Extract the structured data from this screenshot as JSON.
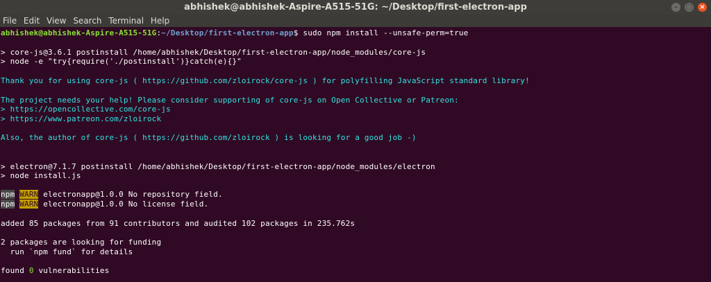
{
  "window": {
    "title": "abhishek@abhishek-Aspire-A515-51G: ~/Desktop/first-electron-app",
    "minimize_glyph": "–",
    "maximize_glyph": "□",
    "close_glyph": "×"
  },
  "menubar": {
    "items": [
      "File",
      "Edit",
      "View",
      "Search",
      "Terminal",
      "Help"
    ]
  },
  "prompt": {
    "user_host": "abhishek@abhishek-Aspire-A515-51G",
    "separator": ":",
    "path": "~/Desktop/first-electron-app",
    "command": "$ sudo npm install --unsafe-perm=true"
  },
  "output": {
    "corejs_postinstall": "> core-js@3.6.1 postinstall /home/abhishek/Desktop/first-electron-app/node_modules/core-js",
    "corejs_node": "> node -e \"try{require('./postinstall')}catch(e){}\"",
    "thanks": "Thank you for using core-js ( https://github.com/zloirock/core-js ) for polyfilling JavaScript standard library!",
    "needs_help": "The project needs your help! Please consider supporting of core-js on Open Collective or Patreon:",
    "opencollective": "> https://opencollective.com/core-js",
    "patreon": "> https://www.patreon.com/zloirock",
    "author": "Also, the author of core-js ( https://github.com/zloirock ) is looking for a good job -)",
    "electron_postinstall": "> electron@7.1.7 postinstall /home/abhishek/Desktop/first-electron-app/node_modules/electron",
    "electron_node": "> node install.js",
    "warn1_npm": "npm",
    "warn1_tag": "WARN",
    "warn1_text": " electronapp@1.0.0 No repository field.",
    "warn2_npm": "npm",
    "warn2_tag": "WARN",
    "warn2_text": " electronapp@1.0.0 No license field.",
    "added": "added 85 packages from 91 contributors and audited 102 packages in 235.762s",
    "funding1": "2 packages are looking for funding",
    "funding2": "  run `npm fund` for details",
    "found_pre": "found ",
    "found_count": "0",
    "found_post": " vulnerabilities"
  },
  "colors": {
    "terminal_bg": "#300a24",
    "user_host": "#8ae234",
    "path": "#729fcf",
    "cyan_text": "#34e2e2",
    "warn_bg": "#c4a000",
    "title_bar": "#3e3d39",
    "close_button": "#e95420"
  }
}
